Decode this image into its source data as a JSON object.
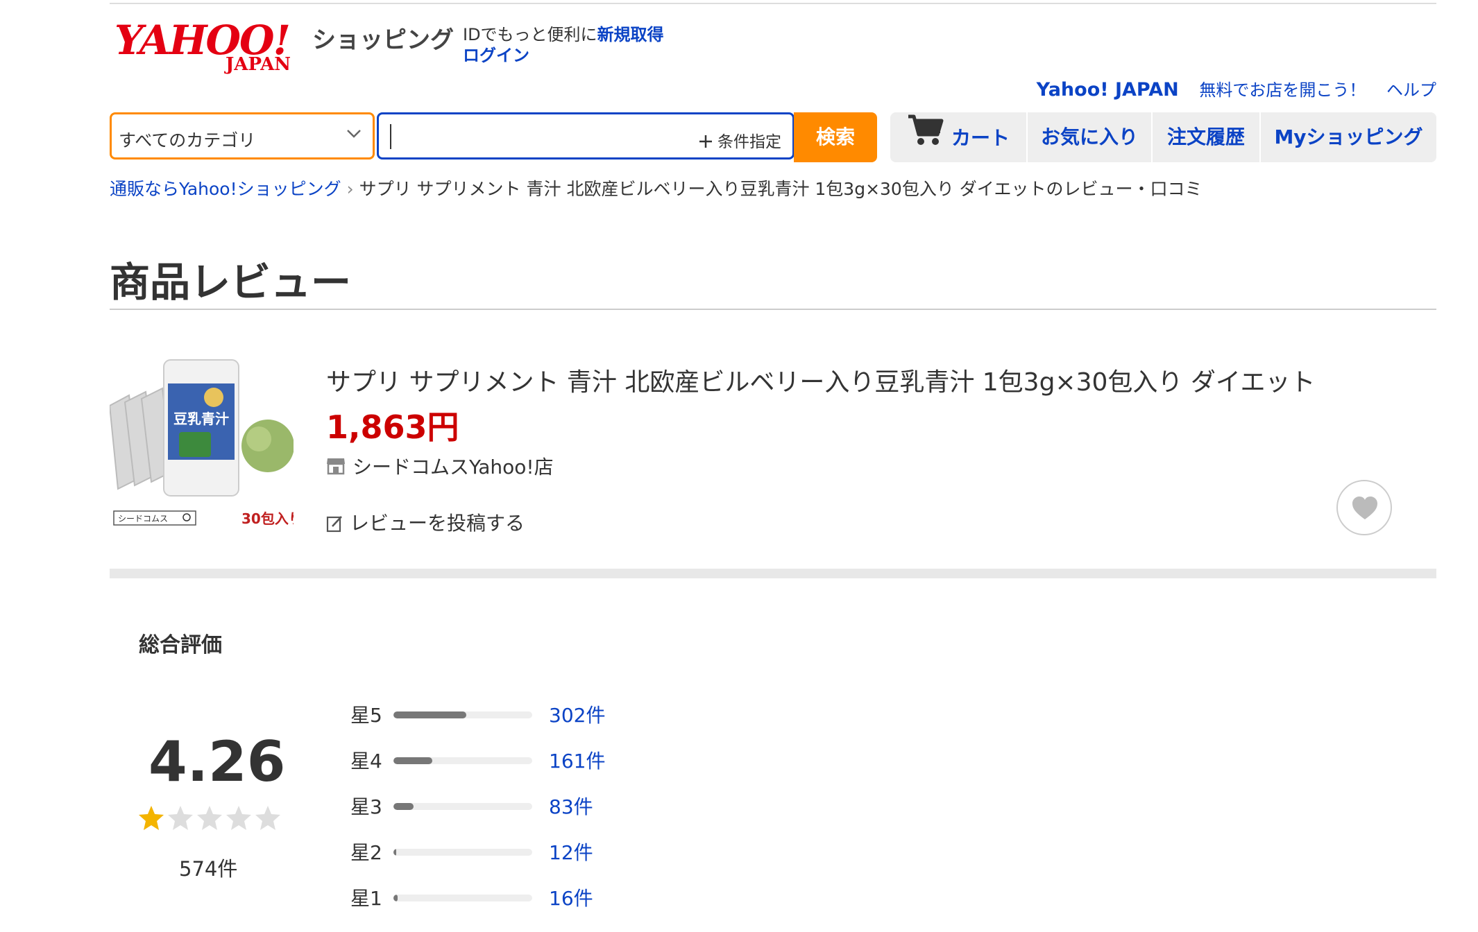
{
  "header": {
    "logo": {
      "main": "YAHOO!",
      "sub": "JAPAN"
    },
    "brand": "ショッピング",
    "id_prompt": "IDでもっと便利に",
    "register_link": "新規取得",
    "login_link": "ログイン",
    "top_links": [
      "Yahoo! JAPAN",
      "無料でお店を開こう！",
      "ヘルプ"
    ]
  },
  "search": {
    "category": "すべてのカテゴリ",
    "query": "",
    "condition_button": "条件指定",
    "submit_label": "検索"
  },
  "nav": {
    "cart": "カート",
    "favorites": "お気に入り",
    "orders": "注文履歴",
    "my_shopping": "Myショッピング"
  },
  "breadcrumb": {
    "home": "通販ならYahoo!ショッピング",
    "current": "サプリ サプリメント 青汁 北欧産ビルベリー入り豆乳青汁 1包3g×30包入り ダイエットのレビュー・口コミ"
  },
  "page": {
    "title": "商品レビュー"
  },
  "product": {
    "name": "サプリ サプリメント 青汁 北欧産ビルベリー入り豆乳青汁 1包3g×30包入り ダイエット",
    "price": "1,863円",
    "store": "シードコムスYahoo!店",
    "write_review": "レビューを投稿する",
    "image_text": {
      "package_title": "豆乳青汁",
      "store_tag": "シードコムス",
      "count_tag": "30包入り"
    }
  },
  "rating": {
    "overall_label": "総合評価",
    "average": "4.26",
    "average_value": 4.26,
    "total": "574件",
    "distribution": [
      {
        "label": "星5",
        "count": "302件",
        "value": 302
      },
      {
        "label": "星4",
        "count": "161件",
        "value": 161
      },
      {
        "label": "星3",
        "count": "83件",
        "value": 83
      },
      {
        "label": "星2",
        "count": "12件",
        "value": 12
      },
      {
        "label": "星1",
        "count": "16件",
        "value": 16
      }
    ],
    "total_value": 574
  },
  "colors": {
    "brand_red": "#e40012",
    "link_blue": "#0b43c5",
    "accent_orange": "#ff8a00",
    "price_red": "#cc0000",
    "star_gold": "#f4b400"
  }
}
